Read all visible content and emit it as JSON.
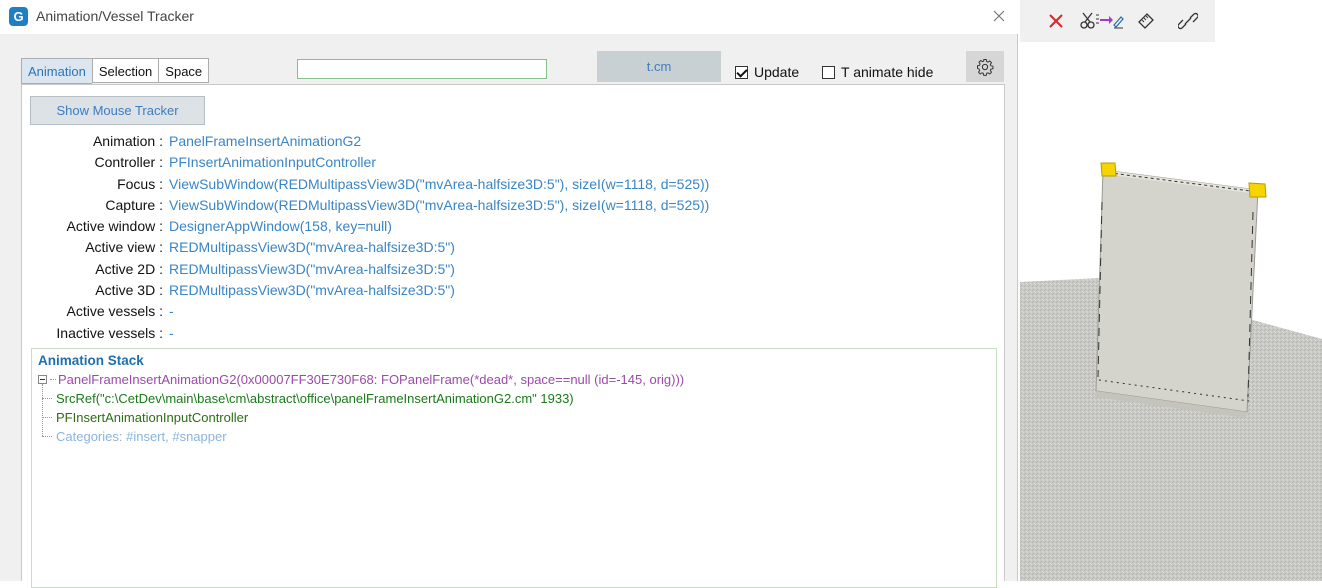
{
  "window": {
    "title": "Animation/Vessel Tracker",
    "app_icon_letter": "G"
  },
  "tabs": [
    {
      "label": "Animation",
      "active": true
    },
    {
      "label": "Selection",
      "active": false
    },
    {
      "label": "Space",
      "active": false
    }
  ],
  "filter": {
    "value": ""
  },
  "tcm_button": "t.cm",
  "update_checkbox": {
    "label": "Update",
    "checked": true
  },
  "animate_hide_checkbox": {
    "label": "T animate hide",
    "checked": false
  },
  "mouse_tracker_button": "Show Mouse Tracker",
  "info": [
    {
      "key": "Animation :",
      "value": "PanelFrameInsertAnimationG2"
    },
    {
      "key": "Controller :",
      "value": "PFInsertAnimationInputController"
    },
    {
      "key": "Focus :",
      "value": "ViewSubWindow(REDMultipassView3D(\"mvArea-halfsize3D:5\"), sizeI(w=1118, d=525))"
    },
    {
      "key": "Capture :",
      "value": "ViewSubWindow(REDMultipassView3D(\"mvArea-halfsize3D:5\"), sizeI(w=1118, d=525))"
    },
    {
      "key": "Active window :",
      "value": "DesignerAppWindow(158, key=null)"
    },
    {
      "key": "Active view :",
      "value": "REDMultipassView3D(\"mvArea-halfsize3D:5\")"
    },
    {
      "key": "Active 2D :",
      "value": "REDMultipassView3D(\"mvArea-halfsize3D:5\")"
    },
    {
      "key": "Active 3D :",
      "value": "REDMultipassView3D(\"mvArea-halfsize3D:5\")"
    },
    {
      "key": "Active vessels :",
      "value": "-"
    },
    {
      "key": "Inactive vessels :",
      "value": "-"
    }
  ],
  "stack": {
    "title": "Animation Stack",
    "root": "PanelFrameInsertAnimationG2(0x00007FF30E730F68: FOPanelFrame(*dead*, space==null (id=-145, orig)))",
    "children": [
      "SrcRef(\"c:\\CetDev\\main\\base\\cm\\abstract\\office\\panelFrameInsertAnimationG2.cm\" 1933)",
      "PFInsertAnimationInputController",
      "Categories: #insert, #snapper"
    ]
  },
  "toolbar_icons": [
    "close-red-icon",
    "cut-insert-icon",
    "ruler-icon",
    "link-icon"
  ],
  "colors": {
    "link_blue": "#3a85c5",
    "tab_active_bg": "#dbe6f0",
    "stack_title": "#1e6fb0",
    "stack_root": "#9b4aa8",
    "stack_srcref": "#1a7a1a",
    "stack_faded": "#8ab4dc",
    "handle_yellow": "#f5d400"
  }
}
